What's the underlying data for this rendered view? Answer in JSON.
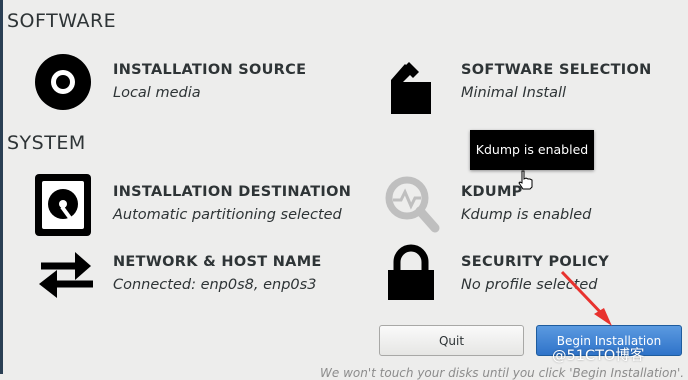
{
  "sections": {
    "software_title": "SOFTWARE",
    "system_title": "SYSTEM"
  },
  "spokes": {
    "installation_source": {
      "title": "INSTALLATION SOURCE",
      "status": "Local media",
      "icon": "disc-icon"
    },
    "software_selection": {
      "title": "SOFTWARE SELECTION",
      "status": "Minimal Install",
      "icon": "package-icon"
    },
    "installation_destination": {
      "title": "INSTALLATION DESTINATION",
      "status": "Automatic partitioning selected",
      "icon": "harddisk-icon"
    },
    "kdump": {
      "title": "KDUMP",
      "status": "Kdump is enabled",
      "icon": "magnifier-icon"
    },
    "network": {
      "title": "NETWORK & HOST NAME",
      "status": "Connected: enp0s8, enp0s3",
      "icon": "network-arrows-icon"
    },
    "security_policy": {
      "title": "SECURITY POLICY",
      "status": "No profile selected",
      "icon": "padlock-icon"
    }
  },
  "tooltip": {
    "text": "Kdump is enabled"
  },
  "buttons": {
    "quit": "Quit",
    "begin_installation": "Begin Installation"
  },
  "footnote": "We won't touch your disks until you click 'Begin Installation'.",
  "watermark": "@51CTO博客",
  "colors": {
    "background": "#ededec",
    "accent_button": "#3a7fd5",
    "tooltip_bg": "#000000",
    "annotation_arrow": "#e8322e"
  }
}
